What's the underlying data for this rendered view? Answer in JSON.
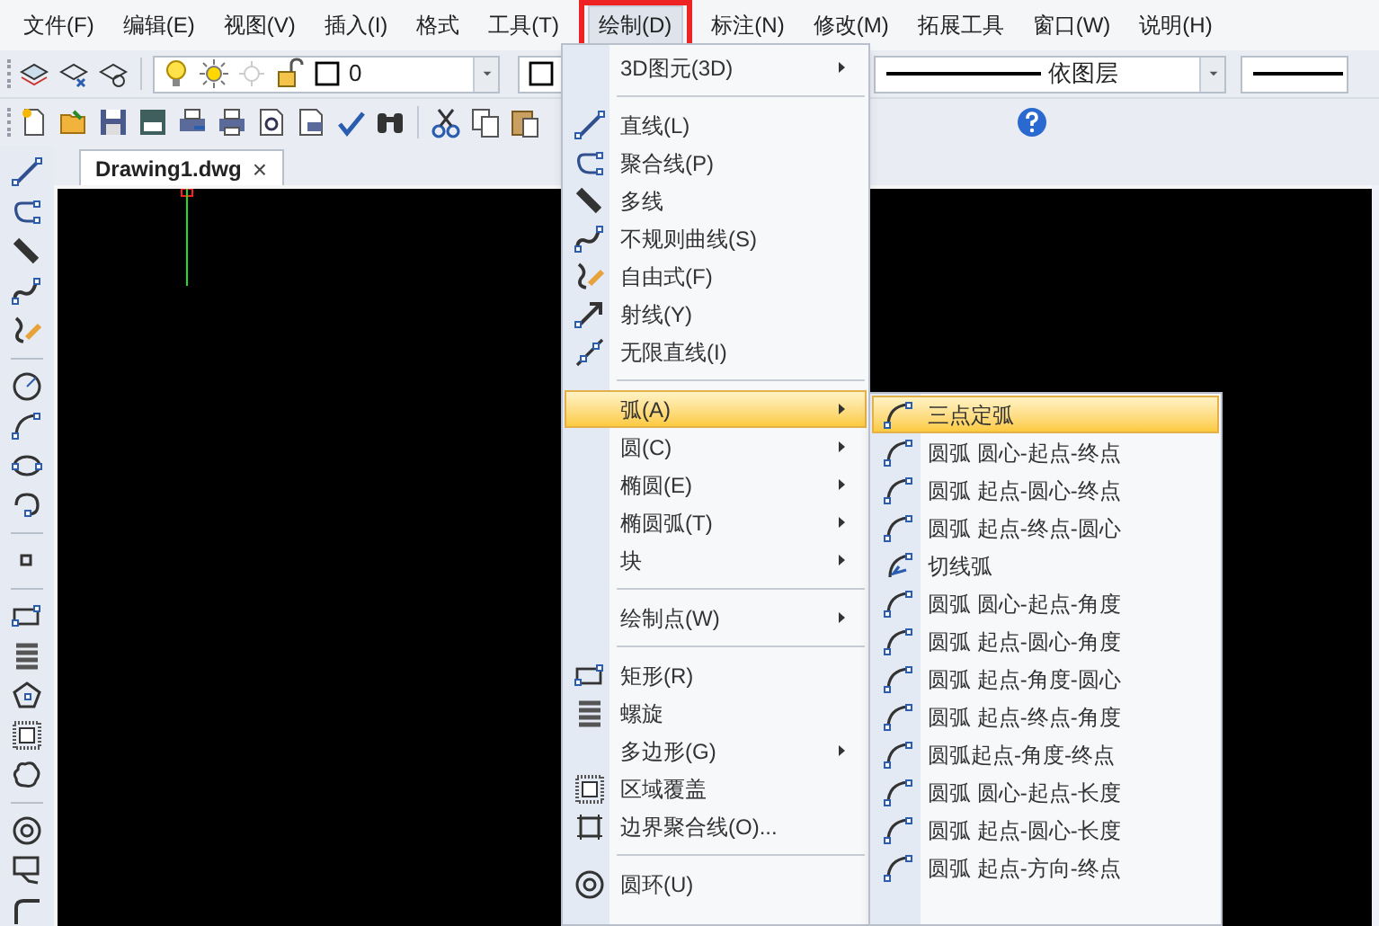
{
  "menu_bar": [
    {
      "label": "文件(F)",
      "selected": false,
      "highlighted": false
    },
    {
      "label": "编辑(E)",
      "selected": false,
      "highlighted": false
    },
    {
      "label": "视图(V)",
      "selected": false,
      "highlighted": false
    },
    {
      "label": "插入(I)",
      "selected": false,
      "highlighted": false
    },
    {
      "label": "格式",
      "selected": false,
      "highlighted": false
    },
    {
      "label": "工具(T)",
      "selected": false,
      "highlighted": false
    },
    {
      "label": "绘制(D)",
      "selected": true,
      "highlighted": true
    },
    {
      "label": "标注(N)",
      "selected": false,
      "highlighted": false
    },
    {
      "label": "修改(M)",
      "selected": false,
      "highlighted": false
    },
    {
      "label": "拓展工具",
      "selected": false,
      "highlighted": false
    },
    {
      "label": "窗口(W)",
      "selected": false,
      "highlighted": false
    },
    {
      "label": "说明(H)",
      "selected": false,
      "highlighted": false
    }
  ],
  "layer_combo": {
    "value": "0"
  },
  "linetype_combo": {
    "value": "依图层"
  },
  "document_tab": {
    "title": "Drawing1.dwg",
    "close": "×"
  },
  "draw_menu": [
    {
      "kind": "item",
      "label": "3D图元(3D)",
      "submenu": true,
      "selected": false
    },
    {
      "kind": "separator"
    },
    {
      "kind": "item",
      "label": "直线(L)",
      "submenu": false,
      "selected": false
    },
    {
      "kind": "item",
      "label": "聚合线(P)",
      "submenu": false,
      "selected": false
    },
    {
      "kind": "item",
      "label": "多线",
      "submenu": false,
      "selected": false
    },
    {
      "kind": "item",
      "label": "不规则曲线(S)",
      "submenu": false,
      "selected": false
    },
    {
      "kind": "item",
      "label": "自由式(F)",
      "submenu": false,
      "selected": false
    },
    {
      "kind": "item",
      "label": "射线(Y)",
      "submenu": false,
      "selected": false
    },
    {
      "kind": "item",
      "label": "无限直线(I)",
      "submenu": false,
      "selected": false
    },
    {
      "kind": "separator"
    },
    {
      "kind": "item",
      "label": "弧(A)",
      "submenu": true,
      "selected": true
    },
    {
      "kind": "item",
      "label": "圆(C)",
      "submenu": true,
      "selected": false
    },
    {
      "kind": "item",
      "label": "椭圆(E)",
      "submenu": true,
      "selected": false
    },
    {
      "kind": "item",
      "label": "椭圆弧(T)",
      "submenu": true,
      "selected": false
    },
    {
      "kind": "item",
      "label": "块",
      "submenu": true,
      "selected": false
    },
    {
      "kind": "separator"
    },
    {
      "kind": "item",
      "label": "绘制点(W)",
      "submenu": true,
      "selected": false
    },
    {
      "kind": "separator"
    },
    {
      "kind": "item",
      "label": "矩形(R)",
      "submenu": false,
      "selected": false
    },
    {
      "kind": "item",
      "label": "螺旋",
      "submenu": false,
      "selected": false
    },
    {
      "kind": "item",
      "label": "多边形(G)",
      "submenu": true,
      "selected": false
    },
    {
      "kind": "item",
      "label": "区域覆盖",
      "submenu": false,
      "selected": false
    },
    {
      "kind": "item",
      "label": "边界聚合线(O)...",
      "submenu": false,
      "selected": false
    },
    {
      "kind": "separator"
    },
    {
      "kind": "item",
      "label": "圆环(U)",
      "submenu": false,
      "selected": false
    }
  ],
  "arc_submenu": [
    {
      "label": "三点定弧",
      "selected": true
    },
    {
      "label": "圆弧 圆心-起点-终点",
      "selected": false
    },
    {
      "label": "圆弧 起点-圆心-终点",
      "selected": false
    },
    {
      "label": "圆弧 起点-终点-圆心",
      "selected": false
    },
    {
      "label": "切线弧",
      "selected": false
    },
    {
      "label": "圆弧 圆心-起点-角度",
      "selected": false
    },
    {
      "label": "圆弧 起点-圆心-角度",
      "selected": false
    },
    {
      "label": "圆弧 起点-角度-圆心",
      "selected": false
    },
    {
      "label": "圆弧 起点-终点-角度",
      "selected": false
    },
    {
      "label": "圆弧起点-角度-终点",
      "selected": false
    },
    {
      "label": "圆弧 圆心-起点-长度",
      "selected": false
    },
    {
      "label": "圆弧 起点-圆心-长度",
      "selected": false
    },
    {
      "label": "圆弧 起点-方向-终点",
      "selected": false
    }
  ]
}
